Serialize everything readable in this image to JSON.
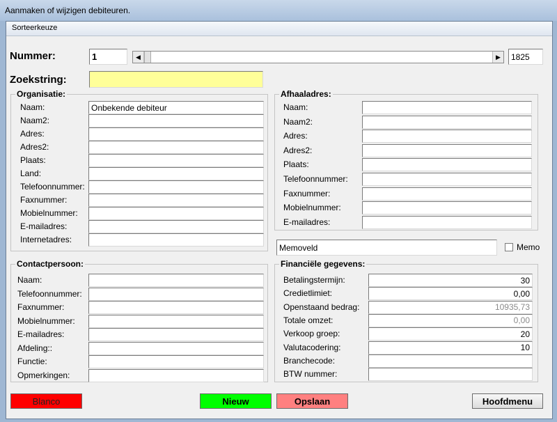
{
  "window": {
    "title": "Aanmaken of wijzigen debiteuren."
  },
  "menu": {
    "sort_label": "Sorteerkeuze"
  },
  "top": {
    "nummer_label": "Nummer:",
    "nummer_value": "1",
    "total_value": "1825",
    "zoek_label": "Zoekstring:",
    "zoek_value": ""
  },
  "organisatie": {
    "legend": "Organisatie:",
    "fields": [
      {
        "label": "Naam:",
        "value": "Onbekende debiteur"
      },
      {
        "label": "Naam2:",
        "value": ""
      },
      {
        "label": "Adres:",
        "value": ""
      },
      {
        "label": "Adres2:",
        "value": ""
      },
      {
        "label": "Plaats:",
        "value": ""
      },
      {
        "label": "Land:",
        "value": ""
      },
      {
        "label": "Telefoonnummer:",
        "value": ""
      },
      {
        "label": "Faxnummer:",
        "value": ""
      },
      {
        "label": "Mobielnummer:",
        "value": ""
      },
      {
        "label": "E-mailadres:",
        "value": ""
      },
      {
        "label": "Internetadres:",
        "value": ""
      }
    ]
  },
  "afhaal": {
    "legend": "Afhaaladres:",
    "fields": [
      {
        "label": "Naam:",
        "value": ""
      },
      {
        "label": "Naam2:",
        "value": ""
      },
      {
        "label": "Adres:",
        "value": ""
      },
      {
        "label": "Adres2:",
        "value": ""
      },
      {
        "label": "Plaats:",
        "value": ""
      },
      {
        "label": "Telefoonnummer:",
        "value": ""
      },
      {
        "label": "Faxnummer:",
        "value": ""
      },
      {
        "label": "Mobielnummer:",
        "value": ""
      },
      {
        "label": "E-mailadres:",
        "value": ""
      }
    ]
  },
  "memo": {
    "field_value": "Memoveld",
    "check_label": "Memo",
    "checked": false
  },
  "contact": {
    "legend": "Contactpersoon:",
    "fields": [
      {
        "label": "Naam:",
        "value": ""
      },
      {
        "label": "Telefoonnummer:",
        "value": ""
      },
      {
        "label": "Faxnummer:",
        "value": ""
      },
      {
        "label": "Mobielnummer:",
        "value": ""
      },
      {
        "label": "E-mailadres:",
        "value": ""
      },
      {
        "label": "Afdeling::",
        "value": ""
      },
      {
        "label": "Functie:",
        "value": ""
      },
      {
        "label": "Opmerkingen:",
        "value": ""
      }
    ]
  },
  "financieel": {
    "legend": "Financiële gegevens:",
    "fields": [
      {
        "label": "Betalingstermijn:",
        "value": "30"
      },
      {
        "label": "Credietlimiet:",
        "value": "0,00"
      },
      {
        "label": "Openstaand bedrag:",
        "value": "10935,73"
      },
      {
        "label": "Totale omzet:",
        "value": "0,00"
      },
      {
        "label": "Verkoop groep:",
        "value": "20"
      },
      {
        "label": "Valutacodering:",
        "value": "10"
      },
      {
        "label": "Branchecode:",
        "value": ""
      },
      {
        "label": "BTW nummer:",
        "value": ""
      }
    ]
  },
  "buttons": {
    "blanco": "Blanco",
    "nieuw": "Nieuw",
    "opslaan": "Opslaan",
    "hoofdmenu": "Hoofdmenu"
  },
  "colors": {
    "blanco": "#ff0000",
    "nieuw": "#00ff00",
    "opslaan": "#ff8080",
    "zoekstring": "#ffff99"
  }
}
